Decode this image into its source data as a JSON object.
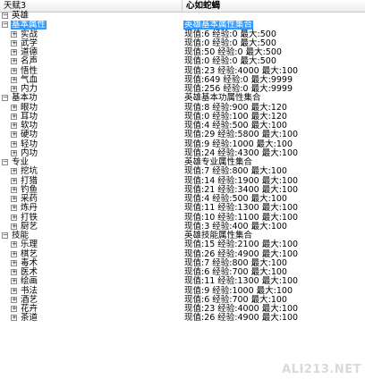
{
  "header": {
    "col1": "天赋3",
    "col2": "心如蛇蝎"
  },
  "rows": [
    {
      "level": 0,
      "toggle": "minus",
      "name": "英雄",
      "value": ""
    },
    {
      "level": 1,
      "toggle": "minus",
      "name": "基本属性",
      "value": "英雄基本属性集合",
      "selected": true
    },
    {
      "level": 2,
      "toggle": "plus",
      "name": "实战",
      "value": "现值:6 经验:0 最大:500"
    },
    {
      "level": 2,
      "toggle": "plus",
      "name": "武学",
      "value": "现值:0 经验:0 最大:500"
    },
    {
      "level": 2,
      "toggle": "plus",
      "name": "道德",
      "value": "现值:50 经验:0 最大:500"
    },
    {
      "level": 2,
      "toggle": "plus",
      "name": "名声",
      "value": "现值:0 经验:0 最大:500"
    },
    {
      "level": 2,
      "toggle": "plus",
      "name": "悟性",
      "value": "现值:23 经验:4000 最大:100"
    },
    {
      "level": 2,
      "toggle": "plus",
      "name": "气血",
      "value": "现值:649 经验:0 最大:9999"
    },
    {
      "level": 2,
      "toggle": "plus",
      "name": "内力",
      "value": "现值:256 经验:0 最大:9999"
    },
    {
      "level": 1,
      "toggle": "minus",
      "name": "基本功",
      "value": "英雄基本功属性集合"
    },
    {
      "level": 2,
      "toggle": "plus",
      "name": "眼功",
      "value": "现值:8 经验:900 最大:120"
    },
    {
      "level": 2,
      "toggle": "plus",
      "name": "耳功",
      "value": "现值:0 经验:100 最大:120"
    },
    {
      "level": 2,
      "toggle": "plus",
      "name": "软功",
      "value": "现值:4 经验:500 最大:100"
    },
    {
      "level": 2,
      "toggle": "plus",
      "name": "硬功",
      "value": "现值:29 经验:5800 最大:100"
    },
    {
      "level": 2,
      "toggle": "plus",
      "name": "轻功",
      "value": "现值:9 经验:1000 最大:100"
    },
    {
      "level": 2,
      "toggle": "plus",
      "name": "内功",
      "value": "现值:24 经验:4300 最大:100"
    },
    {
      "level": 1,
      "toggle": "minus",
      "name": "专业",
      "value": "英雄专业属性集合"
    },
    {
      "level": 2,
      "toggle": "plus",
      "name": "挖坑",
      "value": "现值:7 经验:800 最大:100"
    },
    {
      "level": 2,
      "toggle": "plus",
      "name": "打猎",
      "value": "现值:14 经验:1900 最大:100"
    },
    {
      "level": 2,
      "toggle": "plus",
      "name": "钓鱼",
      "value": "现值:21 经验:3400 最大:100"
    },
    {
      "level": 2,
      "toggle": "plus",
      "name": "采药",
      "value": "现值:4 经验:500 最大:100"
    },
    {
      "level": 2,
      "toggle": "plus",
      "name": "炼丹",
      "value": "现值:11 经验:1300 最大:100"
    },
    {
      "level": 2,
      "toggle": "plus",
      "name": "打铁",
      "value": "现值:10 经验:1100 最大:100"
    },
    {
      "level": 2,
      "toggle": "plus",
      "name": "厨艺",
      "value": "现值:3 经验:400 最大:100"
    },
    {
      "level": 1,
      "toggle": "minus",
      "name": "技能",
      "value": "英雄技能属性集合"
    },
    {
      "level": 2,
      "toggle": "plus",
      "name": "乐理",
      "value": "现值:15 经验:2100 最大:100"
    },
    {
      "level": 2,
      "toggle": "plus",
      "name": "棋艺",
      "value": "现值:26 经验:4900 最大:100"
    },
    {
      "level": 2,
      "toggle": "plus",
      "name": "毒术",
      "value": "现值:7 经验:800 最大:100"
    },
    {
      "level": 2,
      "toggle": "plus",
      "name": "医术",
      "value": "现值:6 经验:700 最大:100"
    },
    {
      "level": 2,
      "toggle": "plus",
      "name": "绘画",
      "value": "现值:11 经验:1300 最大:100"
    },
    {
      "level": 2,
      "toggle": "plus",
      "name": "书法",
      "value": "现值:9 经验:1000 最大:100"
    },
    {
      "level": 2,
      "toggle": "plus",
      "name": "酒艺",
      "value": "现值:6 经验:700 最大:100"
    },
    {
      "level": 2,
      "toggle": "plus",
      "name": "花卉",
      "value": "现值:23 经验:4000 最大:100"
    },
    {
      "level": 2,
      "toggle": "plus",
      "name": "茶道",
      "value": "现值:26 经验:4900 最大:100"
    }
  ],
  "watermark": "ALI213.NET",
  "colors": {
    "selection": "#3399ff",
    "background": "#ffffff"
  }
}
